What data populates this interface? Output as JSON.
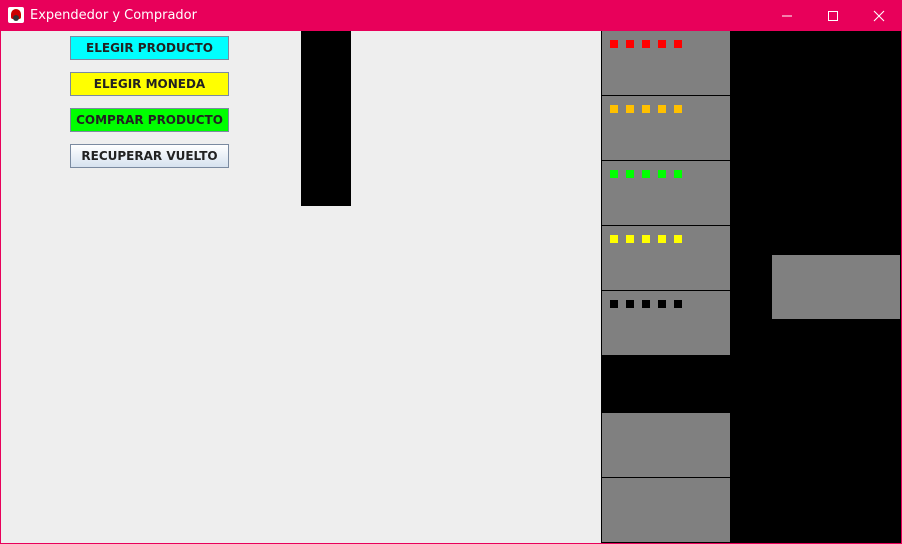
{
  "window": {
    "title": "Expendedor y Comprador"
  },
  "buttons": {
    "elegir_producto": {
      "label": "ELEGIR PRODUCTO",
      "color": "#00ffff"
    },
    "elegir_moneda": {
      "label": "ELEGIR MONEDA",
      "color": "#ffff00"
    },
    "comprar_producto": {
      "label": "COMPRAR PRODUCTO",
      "color": "#00ff00"
    },
    "recuperar_vuelto": {
      "label": "RECUPERAR VUELTO"
    }
  },
  "product_slots": [
    {
      "dot_color": "#ff0000",
      "count": 5
    },
    {
      "dot_color": "#ffc000",
      "count": 5
    },
    {
      "dot_color": "#00ff00",
      "count": 5
    },
    {
      "dot_color": "#ffff00",
      "count": 5
    },
    {
      "dot_color": "#000000",
      "count": 5
    }
  ],
  "colors": {
    "titlebar": "#e8005a",
    "panel_background": "#eeeeee",
    "slot_gray": "#808080"
  }
}
